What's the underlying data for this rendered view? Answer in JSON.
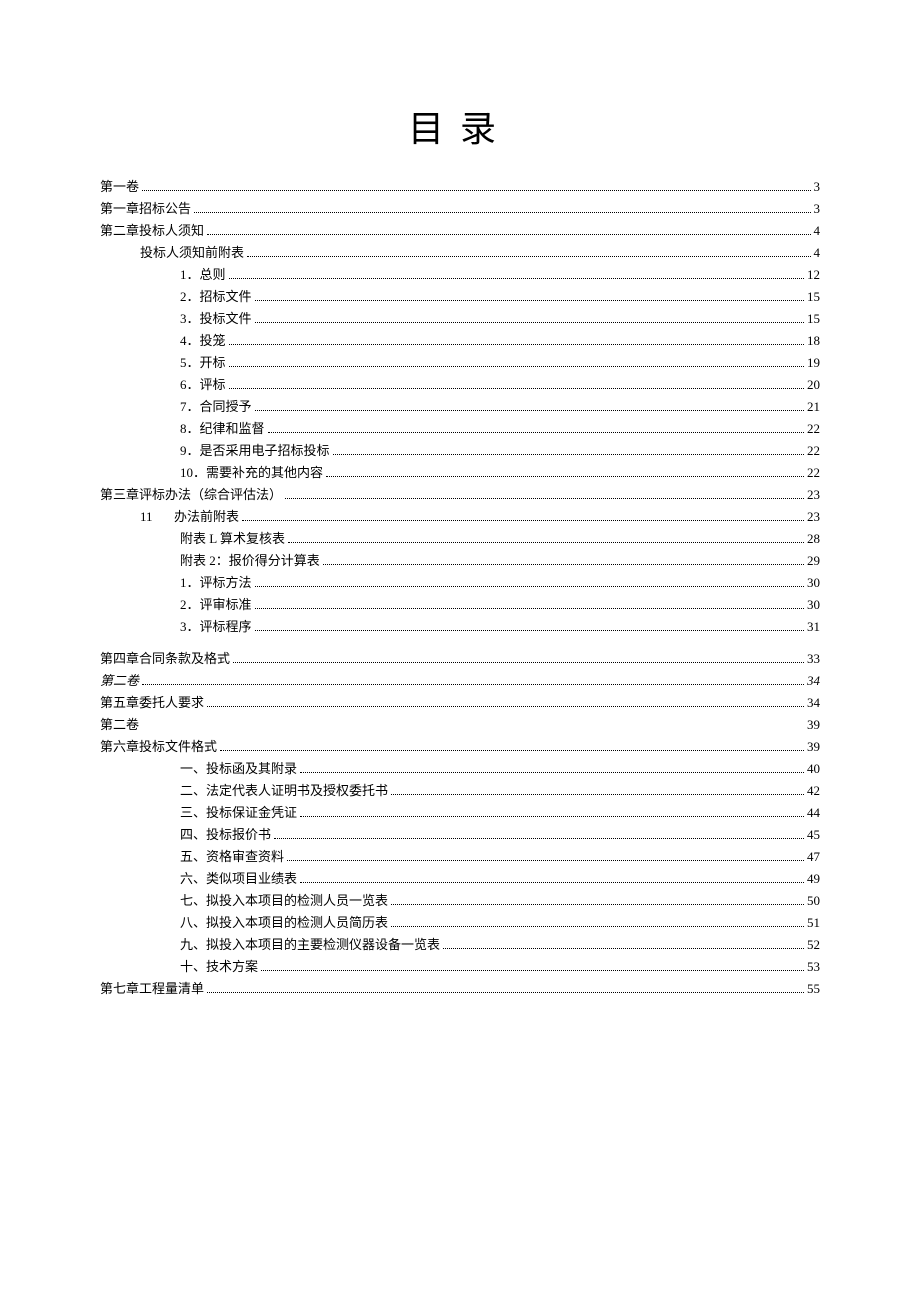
{
  "title": "目录",
  "entries": [
    {
      "indent": 0,
      "label": "第一卷",
      "page": "3"
    },
    {
      "indent": 0,
      "label": "第一章招标公告",
      "page": "3"
    },
    {
      "indent": 0,
      "label": "第二章投标人须知",
      "page": "4"
    },
    {
      "indent": 1,
      "label": "投标人须知前附表",
      "page": "4"
    },
    {
      "indent": 2,
      "num": "1",
      "label": "．总则",
      "page": "12"
    },
    {
      "indent": 2,
      "num": "2",
      "label": "．招标文件",
      "page": "15"
    },
    {
      "indent": 2,
      "num": "3",
      "label": "．投标文件",
      "page": "15"
    },
    {
      "indent": 2,
      "num": "4",
      "label": "．投笼",
      "page": "18"
    },
    {
      "indent": 2,
      "num": "5",
      "label": "．开标",
      "page": "19"
    },
    {
      "indent": 2,
      "num": "6",
      "label": "．评标",
      "page": "20"
    },
    {
      "indent": 2,
      "num": "7",
      "label": "．合同授予",
      "page": "21"
    },
    {
      "indent": 2,
      "num": "8",
      "label": "．纪律和监督",
      "page": "22"
    },
    {
      "indent": 2,
      "num": "9",
      "label": "．是否采用电子招标投标",
      "page": "22"
    },
    {
      "indent": 2,
      "num": "10",
      "label": "．需要补充的其他内容",
      "page": "22"
    },
    {
      "indent": 0,
      "label": "第三章评标办法（综合评估法）",
      "page": "23"
    },
    {
      "indent": 1,
      "num": "11",
      "label": "办法前附表",
      "page": "23",
      "numwide": true
    },
    {
      "indent": 2,
      "label": "附表 L 算术复核表",
      "page": "28"
    },
    {
      "indent": 2,
      "label": "附表 2：报价得分计算表",
      "page": "29"
    },
    {
      "indent": 2,
      "num": "1",
      "label": "．评标方法",
      "page": "30"
    },
    {
      "indent": 2,
      "num": "2",
      "label": "．评审标准",
      "page": "30"
    },
    {
      "indent": 2,
      "num": "3",
      "label": "．评标程序",
      "page": "31"
    },
    {
      "gap": true
    },
    {
      "indent": 0,
      "label": "第四章合同条款及格式",
      "page": "33"
    },
    {
      "indent": 0,
      "label": "第二卷",
      "page": "34",
      "italic": true
    },
    {
      "indent": 0,
      "label": "第五章委托人要求",
      "page": "34"
    },
    {
      "indent": 0,
      "label": "第二卷",
      "page": "39",
      "nodots": true
    },
    {
      "indent": 0,
      "label": "第六章投标文件格式",
      "page": "39"
    },
    {
      "indent": 2,
      "label": "一、投标函及其附录",
      "page": "40"
    },
    {
      "indent": 2,
      "label": "二、法定代表人证明书及授权委托书",
      "page": "42"
    },
    {
      "indent": 2,
      "label": "三、投标保证金凭证",
      "page": "44"
    },
    {
      "indent": 2,
      "label": "四、投标报价书",
      "page": "45"
    },
    {
      "indent": 2,
      "label": "五、资格审查资料",
      "page": "47"
    },
    {
      "indent": 2,
      "label": "六、类似项目业绩表",
      "page": "49"
    },
    {
      "indent": 2,
      "label": "七、拟投入本项目的检测人员一览表",
      "page": "50"
    },
    {
      "indent": 2,
      "label": "八、拟投入本项目的检测人员简历表",
      "page": "51"
    },
    {
      "indent": 2,
      "label": "九、拟投入本项目的主要检测仪器设备一览表",
      "page": "52"
    },
    {
      "indent": 2,
      "label": "十、技术方案",
      "page": "53"
    },
    {
      "indent": 0,
      "label": "第七章工程量清单",
      "page": "55"
    }
  ]
}
